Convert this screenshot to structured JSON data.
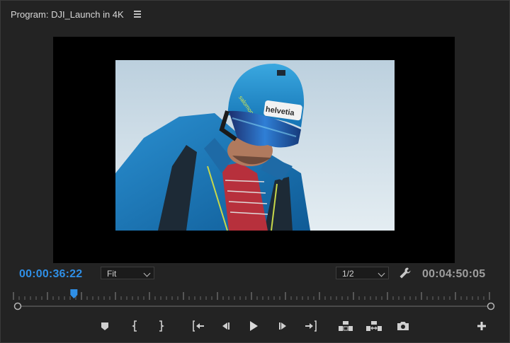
{
  "panel": {
    "title": "Program: DJI_Launch in 4K",
    "menu_icon": "hamburger-menu-icon"
  },
  "viewer": {
    "frame_description_icon": "video-frame",
    "helmet_text": "helvetia",
    "helmet_brand": "salomon"
  },
  "status": {
    "current_timecode": "00:00:36:22",
    "zoom": "Fit",
    "resolution": "1/2",
    "duration_timecode": "00:04:50:05"
  },
  "colors": {
    "accent": "#2f8fe6",
    "background": "#232323",
    "viewer_bg": "#000000"
  },
  "playhead": {
    "position_fraction": 0.127
  },
  "controls": [
    {
      "name": "add-marker-icon",
      "label": "Add Marker"
    },
    {
      "name": "mark-in-icon",
      "label": "Mark In"
    },
    {
      "name": "mark-out-icon",
      "label": "Mark Out"
    },
    {
      "name": "go-to-in-icon",
      "label": "Go to In"
    },
    {
      "name": "step-back-icon",
      "label": "Step Back 1 Frame"
    },
    {
      "name": "play-icon",
      "label": "Play-Stop Toggle"
    },
    {
      "name": "step-forward-icon",
      "label": "Step Forward 1 Frame"
    },
    {
      "name": "go-to-out-icon",
      "label": "Go to Out"
    },
    {
      "name": "lift-icon",
      "label": "Lift"
    },
    {
      "name": "extract-icon",
      "label": "Extract"
    },
    {
      "name": "export-frame-icon",
      "label": "Export Frame"
    },
    {
      "name": "button-editor-icon",
      "label": "Button Editor"
    }
  ]
}
